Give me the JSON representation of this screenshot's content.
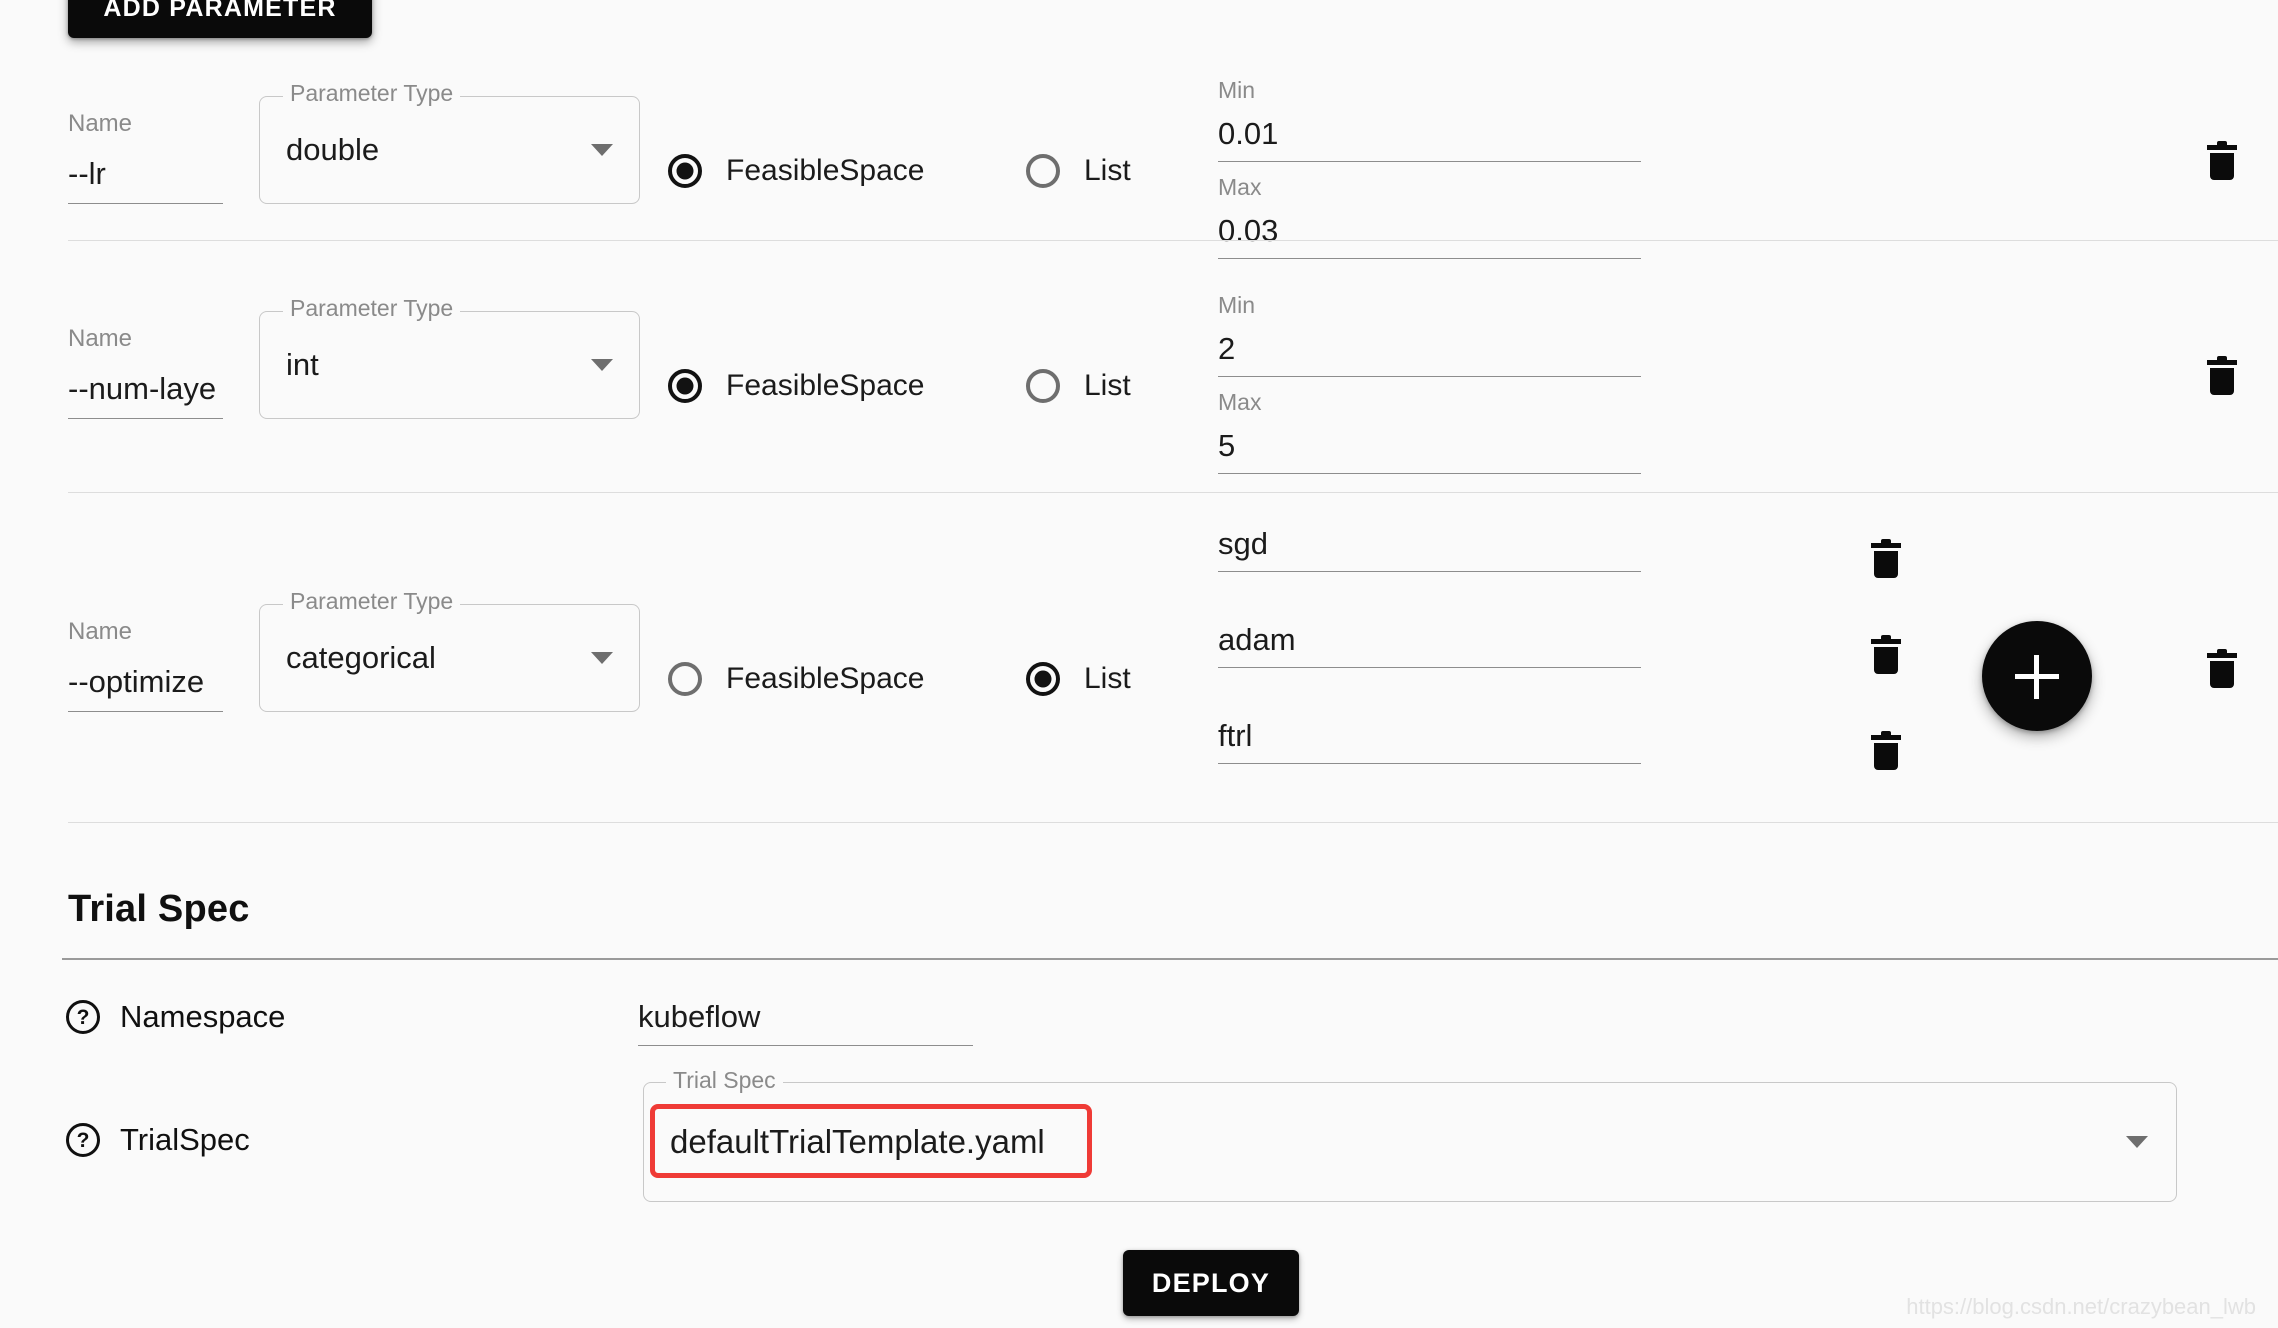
{
  "toolbar": {
    "add_parameter_label": "ADD PARAMETER"
  },
  "labels": {
    "name": "Name",
    "parameter_type": "Parameter Type",
    "feasible_space": "FeasibleSpace",
    "list": "List",
    "min": "Min",
    "max": "Max",
    "help_glyph": "?",
    "trash_icon": "trash-icon",
    "add_icon": "plus-icon",
    "caret_icon": "chevron-down-icon"
  },
  "parameters": [
    {
      "name_value": "--lr",
      "type_value": "double",
      "mode": "feasible_space",
      "min": "0.01",
      "max": "0.03",
      "list": []
    },
    {
      "name_value": "--num-laye",
      "type_value": "int",
      "mode": "feasible_space",
      "min": "2",
      "max": "5",
      "list": []
    },
    {
      "name_value": "--optimize",
      "type_value": "categorical",
      "mode": "list",
      "min": "",
      "max": "",
      "list": [
        "sgd",
        "adam",
        "ftrl"
      ]
    }
  ],
  "trial_spec": {
    "section_title": "Trial Spec",
    "namespace_label": "Namespace",
    "namespace_value": "kubeflow",
    "trialspec_label": "TrialSpec",
    "trialspec_legend": "Trial Spec",
    "trialspec_value": "defaultTrialTemplate.yaml"
  },
  "footer": {
    "deploy_label": "DEPLOY",
    "watermark": "https://blog.csdn.net/crazybean_lwb"
  },
  "colors": {
    "accent_black": "#0a0a0a",
    "annotation_red": "#ef3b36",
    "page_bg": "#fafafa"
  }
}
